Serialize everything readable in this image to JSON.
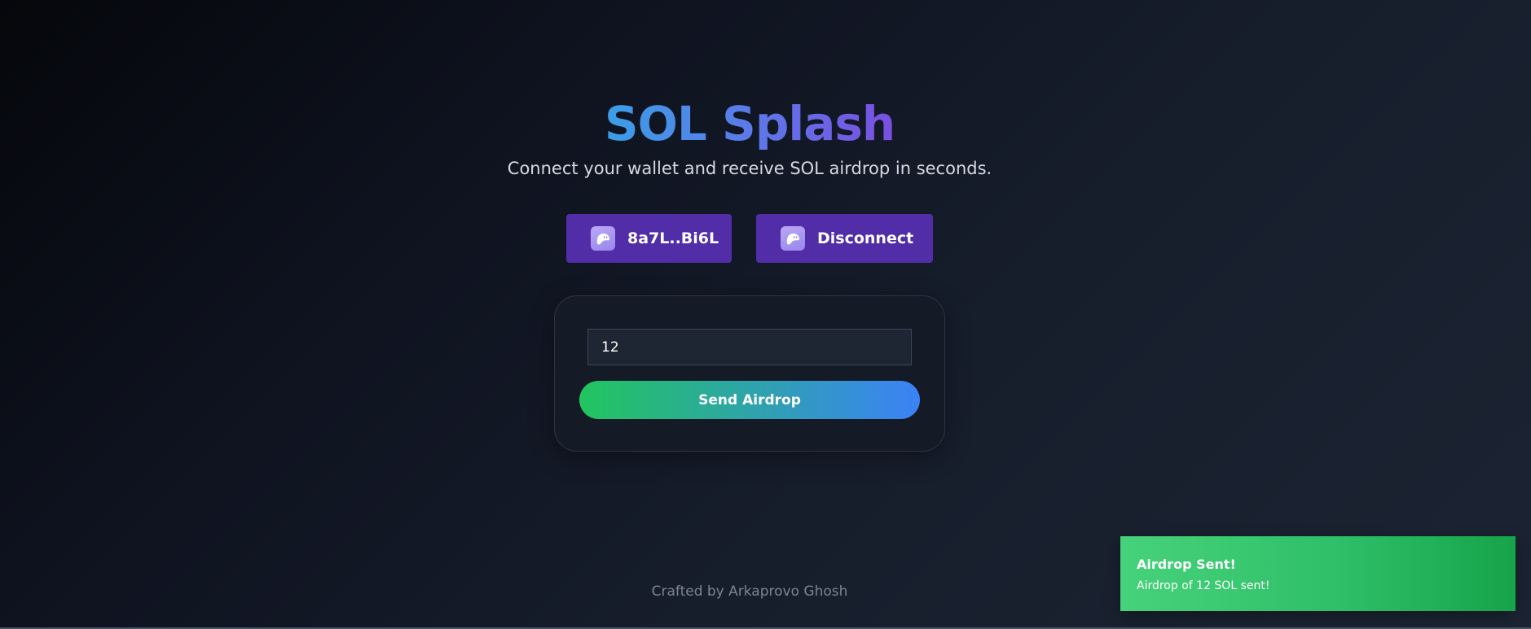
{
  "header": {
    "title": "SOL Splash",
    "subtitle": "Connect your wallet and receive SOL airdrop in seconds."
  },
  "wallet": {
    "address_label": "8a7L..Bi6L",
    "disconnect_label": "Disconnect",
    "icon": "phantom-ghost-icon"
  },
  "airdrop": {
    "amount_value": "12",
    "send_label": "Send Airdrop"
  },
  "footer": {
    "credit": "Crafted by Arkaprovo Ghosh"
  },
  "toast": {
    "title": "Airdrop Sent!",
    "message": "Airdrop of 12 SOL sent!"
  },
  "colors": {
    "wallet_button": "#512da8",
    "send_gradient_start": "#22c55e",
    "send_gradient_end": "#3b82f6",
    "toast_green": "#22c55e"
  }
}
